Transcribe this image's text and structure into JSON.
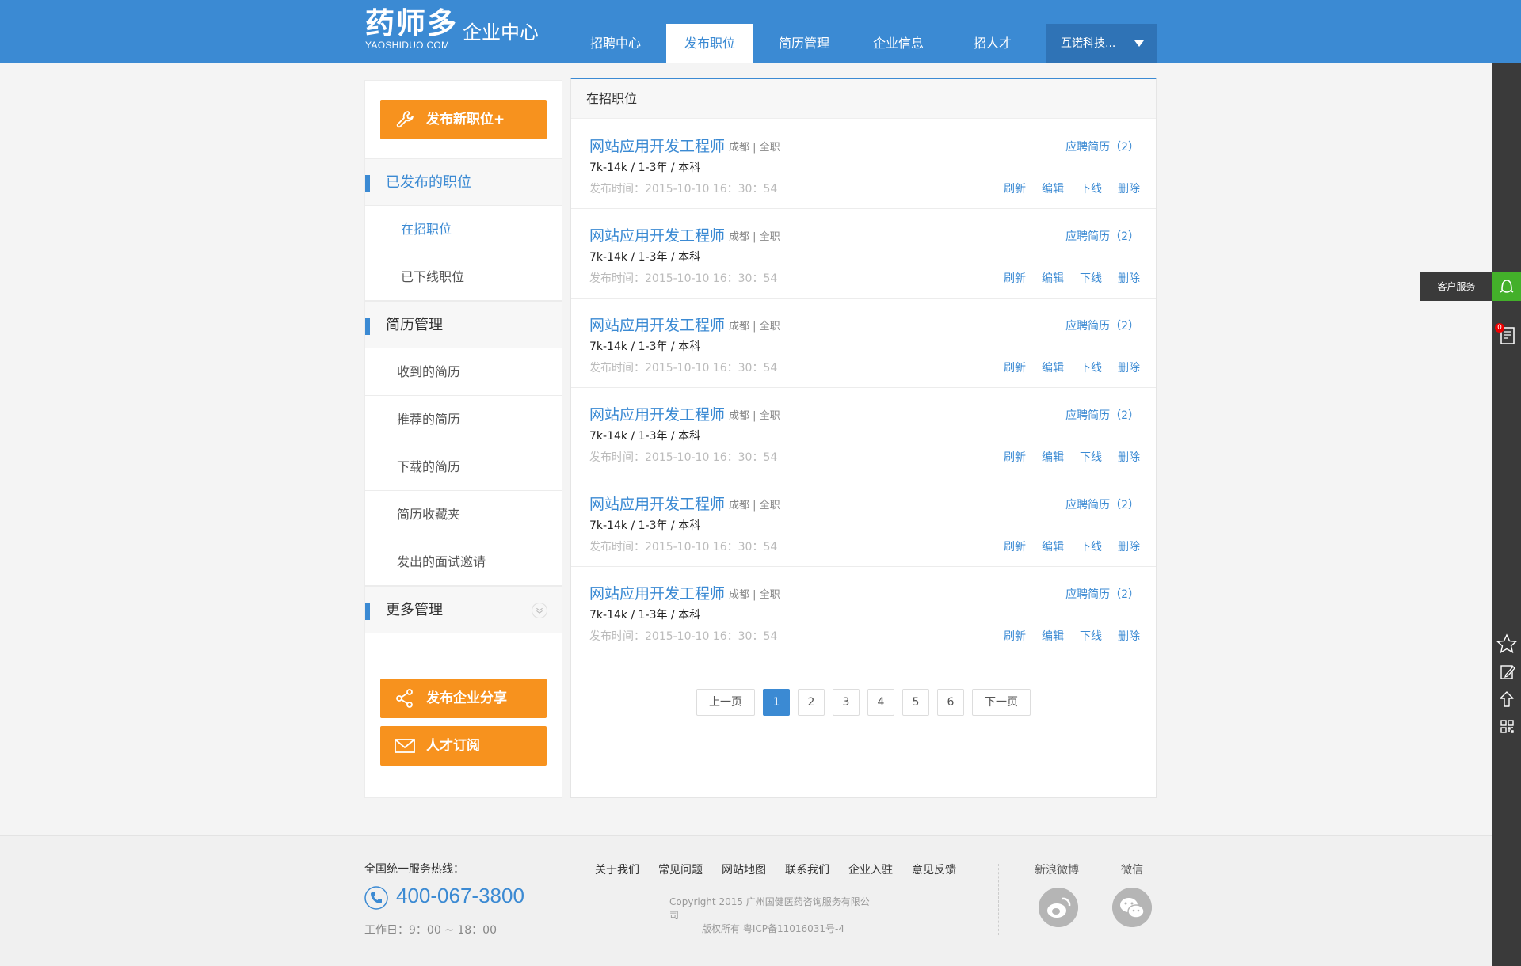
{
  "header": {
    "logo_main": "药师多",
    "logo_sub": "YAOSHIDUO.COM",
    "center_title": "企业中心",
    "nav": [
      {
        "label": "招聘中心"
      },
      {
        "label": "发布职位"
      },
      {
        "label": "简历管理"
      },
      {
        "label": "企业信息"
      },
      {
        "label": "招人才"
      }
    ],
    "active_nav": "发布职位",
    "company": "互诺科技..."
  },
  "sidebar": {
    "post_button": "发布新职位+",
    "groups": [
      {
        "title": "已发布的职位",
        "items": [
          "在招职位",
          "已下线职位"
        ]
      },
      {
        "title": "简历管理",
        "items": [
          "收到的简历",
          "推荐的简历",
          "下载的简历",
          "简历收藏夹",
          "发出的面试邀请"
        ]
      },
      {
        "title": "更多管理",
        "items": []
      }
    ],
    "share_button": "发布企业分享",
    "talent_button": "人才订阅"
  },
  "main": {
    "title": "在招职位",
    "jobs": [
      {
        "title": "网站应用开发工程师",
        "meta": "成都  |  全职",
        "apply": "应聘简历（2）",
        "salary": "7k-14k  /  1-3年  /  本科",
        "time": "发布时间：2015-10-10   16：30：54"
      },
      {
        "title": "网站应用开发工程师",
        "meta": "成都  |  全职",
        "apply": "应聘简历（2）",
        "salary": "7k-14k  /  1-3年  /  本科",
        "time": "发布时间：2015-10-10   16：30：54"
      },
      {
        "title": "网站应用开发工程师",
        "meta": "成都  |  全职",
        "apply": "应聘简历（2）",
        "salary": "7k-14k  /  1-3年  /  本科",
        "time": "发布时间：2015-10-10   16：30：54"
      },
      {
        "title": "网站应用开发工程师",
        "meta": "成都  |  全职",
        "apply": "应聘简历（2）",
        "salary": "7k-14k  /  1-3年  /  本科",
        "time": "发布时间：2015-10-10   16：30：54"
      },
      {
        "title": "网站应用开发工程师",
        "meta": "成都  |  全职",
        "apply": "应聘简历（2）",
        "salary": "7k-14k  /  1-3年  /  本科",
        "time": "发布时间：2015-10-10   16：30：54"
      },
      {
        "title": "网站应用开发工程师",
        "meta": "成都  |  全职",
        "apply": "应聘简历（2）",
        "salary": "7k-14k  /  1-3年  /  本科",
        "time": "发布时间：2015-10-10   16：30：54"
      }
    ],
    "actions": [
      "刷新",
      "编辑",
      "下线",
      "删除"
    ],
    "pager": {
      "prev": "上一页",
      "pages": [
        "1",
        "2",
        "3",
        "4",
        "5",
        "6"
      ],
      "current": "1",
      "next": "下一页"
    }
  },
  "footer": {
    "hotline_label": "全国统一服务热线：",
    "hotline": "400-067-3800",
    "worktime": "工作日：9：00 ~ 18：00",
    "links": [
      "关于我们",
      "常见问题",
      "网站地图",
      "联系我们",
      "企业入驻",
      "意见反馈"
    ],
    "copyright": "Copyright 2015 广州国健医药咨询服务有限公司",
    "icp": "版权所有    粤ICP备11016031号-4",
    "social": [
      "新浪微博",
      "微信"
    ]
  },
  "toolbar": {
    "service": "客户服务",
    "badge": "0",
    "icons": [
      "qq-icon",
      "notepad-icon",
      "star-icon",
      "edit-icon",
      "arrow-up-icon",
      "qrcode-icon"
    ]
  },
  "colors": {
    "brand": "#3b8ad3",
    "accent": "#f7921e",
    "dark_toolbar": "#3a3a3a",
    "service_green": "#43b02a"
  }
}
